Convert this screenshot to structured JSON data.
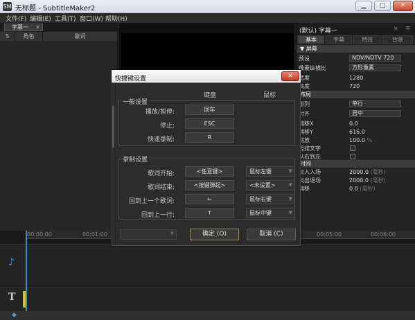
{
  "window": {
    "title": "无标题 - SubtitleMaker2",
    "app_icon": "SM"
  },
  "menu": [
    "文件(F)",
    "编辑(E)",
    "工具(T)",
    "窗口(W)",
    "帮助(H)"
  ],
  "subtitle_panel": {
    "tab_label": "字幕一",
    "columns": [
      "S",
      "角色",
      "歌词"
    ]
  },
  "properties_panel": {
    "title": "(默认) 字幕一",
    "tabs": [
      "基本",
      "字幕",
      "特效",
      "背景"
    ],
    "sections": {
      "screen": "▼ 屏幕",
      "layout": "布局",
      "time": "时间"
    },
    "rows": {
      "preset_label": "预设",
      "preset_value": "NDV/NDTV 720",
      "aspect_label": "像素纵横比",
      "aspect_value": "方形像素",
      "width_label": "宽度",
      "width_value": "1280",
      "height_label": "高度",
      "height_value": "720",
      "align_label": "排列",
      "align_value": "单行",
      "justify_label": "对齐",
      "justify_value": "居中",
      "offset_x_label": "偏移X",
      "offset_x_value": "0.0",
      "offset_y_label": "偏移Y",
      "offset_y_value": "616.0",
      "scale_label": "缩放",
      "scale_value": "100.0",
      "scale_unit": "%",
      "vertical_label": "竖排文字",
      "rtl_label": "从右到左",
      "fade_in_label": "淡入入场",
      "fade_in_value": "2000.0",
      "fade_in_unit": "(毫秒)",
      "fade_out_label": "淡出退场",
      "fade_out_value": "2000.0",
      "fade_out_unit": "(毫秒)",
      "shift_label": "偏移",
      "shift_value": "0.0",
      "shift_unit": "(毫秒)"
    }
  },
  "timeline": {
    "ruler_labels": [
      "00:00:00",
      "00:01:00",
      "00:05:00",
      "00:06:00"
    ]
  },
  "dialog": {
    "title": "快捷键设置",
    "close": "✕",
    "col_key": "键盘",
    "col_mouse": "鼠标",
    "general_group": "一般设置",
    "general_rows": [
      {
        "label": "播放/暂停:",
        "key": "回车"
      },
      {
        "label": "停止:",
        "key": "ESC"
      },
      {
        "label": "快速录制:",
        "key": "R"
      }
    ],
    "record_group": "录制设置",
    "record_rows": [
      {
        "label": "歌词开始:",
        "key": "<任意键>",
        "mouse": "鼠标左键"
      },
      {
        "label": "歌词结束:",
        "key": "<按键弹起>",
        "mouse": "<未设置>"
      },
      {
        "label": "回到上一个歌词:",
        "key": "←",
        "mouse": "鼠标右键"
      },
      {
        "label": "回到上一行:",
        "key": "↑",
        "mouse": "鼠标中键"
      }
    ],
    "ok": "确定 (O)",
    "cancel": "取消 (C)"
  }
}
